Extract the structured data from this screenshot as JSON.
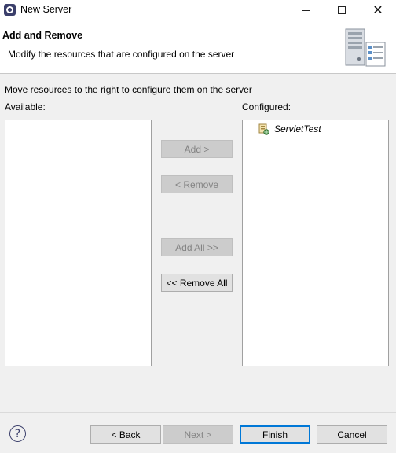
{
  "window": {
    "title": "New Server",
    "app_icon": "eclipse-icon",
    "controls": [
      "minimize-icon",
      "maximize-icon",
      "close-icon"
    ],
    "close_glyph": "✕"
  },
  "banner": {
    "title": "Add and Remove",
    "description": "Modify the resources that are configured on the server",
    "image": "server-wizard-icon"
  },
  "content": {
    "instruction": "Move resources to the right to configure them on the server",
    "available_label": "Available:",
    "configured_label": "Configured:",
    "available_items": [],
    "configured_items": [
      {
        "label": "ServletTest",
        "icon": "web-module-icon"
      }
    ]
  },
  "transfer_buttons": {
    "add": {
      "label": "Add >",
      "enabled": false
    },
    "remove": {
      "label": "< Remove",
      "enabled": false
    },
    "add_all": {
      "label": "Add All >>",
      "enabled": false
    },
    "remove_all": {
      "label": "<< Remove All",
      "enabled": true
    }
  },
  "footer": {
    "help_glyph": "?",
    "back": {
      "label": "< Back",
      "enabled": true
    },
    "next": {
      "label": "Next >",
      "enabled": false
    },
    "finish": {
      "label": "Finish",
      "enabled": true,
      "default": true
    },
    "cancel": {
      "label": "Cancel",
      "enabled": true
    }
  },
  "colors": {
    "accent": "#0078d7",
    "window_bg": "#f0f0f0",
    "banner_bg": "#ffffff",
    "disabled_text": "#838383"
  }
}
